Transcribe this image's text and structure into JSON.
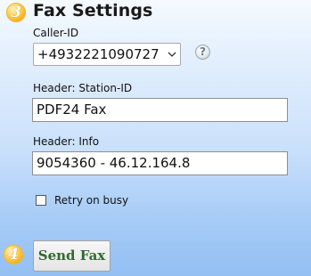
{
  "steps": {
    "fax_settings": "3",
    "send": "4"
  },
  "section_title": "Fax Settings",
  "caller_id": {
    "label": "Caller-ID",
    "selected": "+4932221090727",
    "help_symbol": "?"
  },
  "station_id": {
    "label": "Header: Station-ID",
    "value": "PDF24 Fax"
  },
  "header_info": {
    "label": "Header: Info",
    "value": "9054360 - 46.12.164.8"
  },
  "retry": {
    "label": "Retry on busy",
    "checked": false
  },
  "send_button": "Send Fax",
  "icons": {
    "step_badge": "numbered-circle-icon",
    "help": "question-mark-icon",
    "dropdown": "chevron-down-icon"
  },
  "colors": {
    "badge": "#f2a70e",
    "send_text": "#2f6b2f",
    "background_bottom": "#93bff3"
  }
}
